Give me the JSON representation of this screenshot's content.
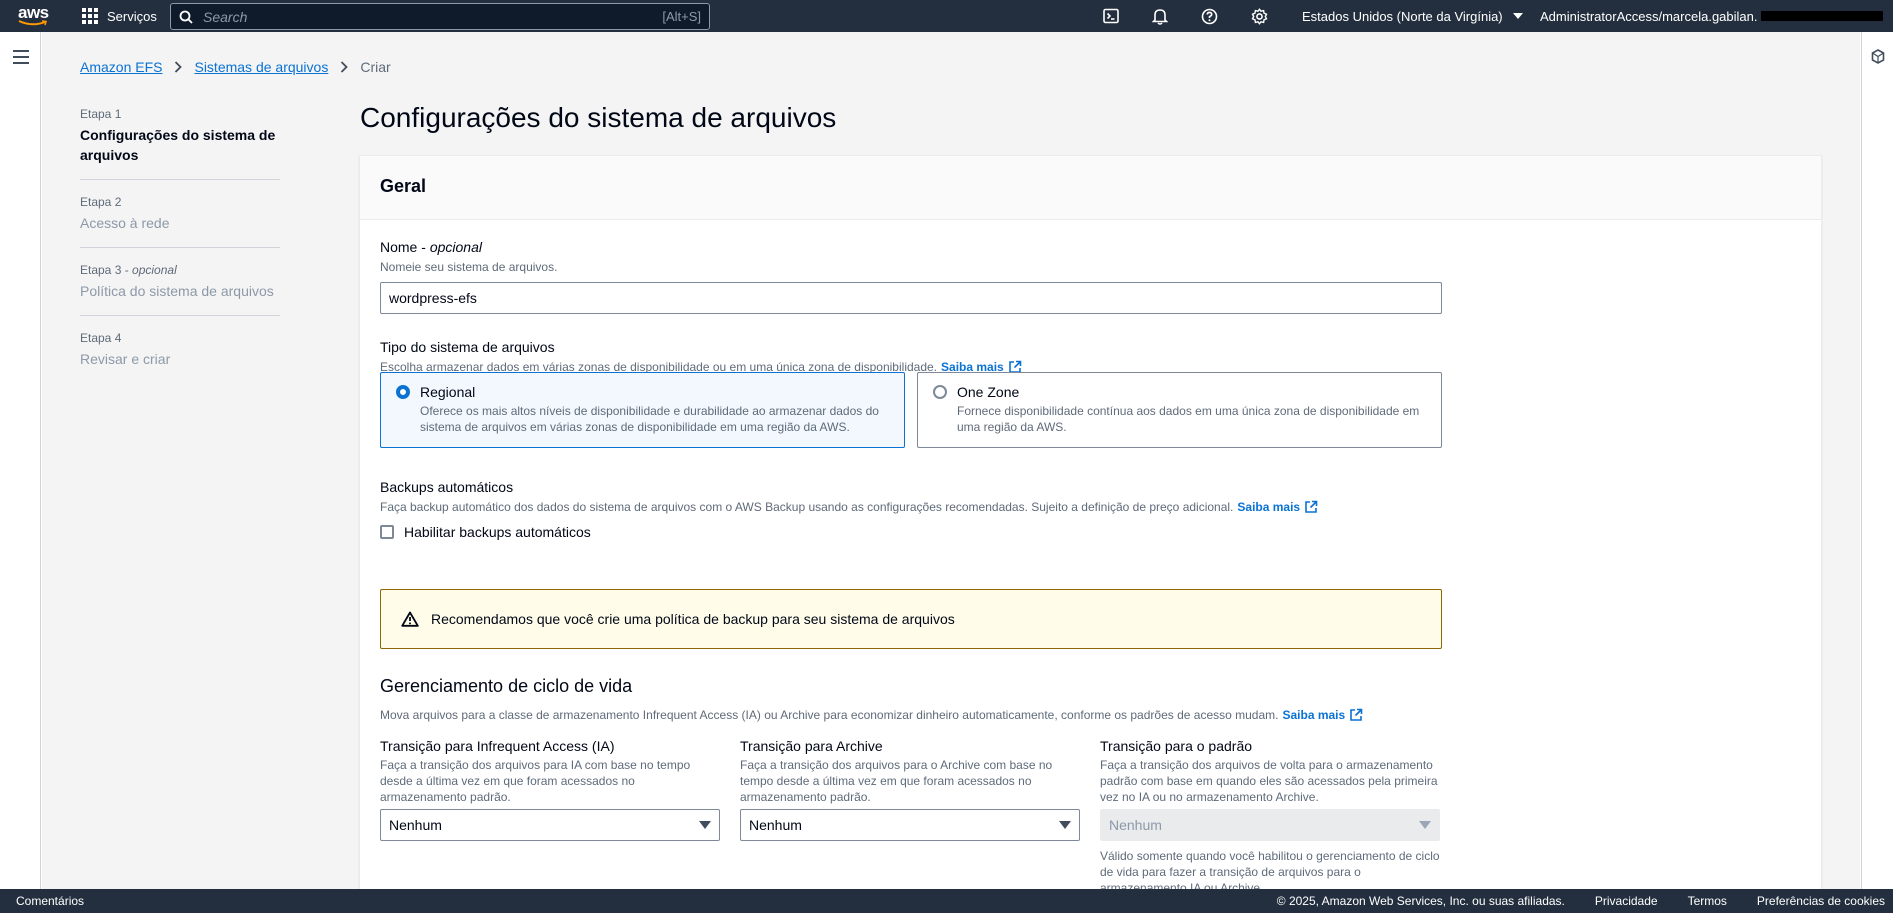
{
  "topnav": {
    "logo_text": "aws",
    "services_label": "Serviços",
    "search_placeholder": "Search",
    "search_shortcut": "[Alt+S]",
    "icons": [
      "cloudshell-icon",
      "bell-icon",
      "help-icon",
      "gear-icon"
    ],
    "region_label": "Estados Unidos (Norte da Virgínia)",
    "account_label": "AdministratorAccess/marcela.gabilan."
  },
  "breadcrumb": {
    "items": [
      "Amazon EFS",
      "Sistemas de arquivos"
    ],
    "current": "Criar"
  },
  "steps": [
    {
      "number": "Etapa 1",
      "optional": "",
      "title": "Configurações do sistema de arquivos",
      "active": true
    },
    {
      "number": "Etapa 2",
      "optional": "",
      "title": "Acesso à rede",
      "active": false
    },
    {
      "number": "Etapa 3",
      "optional": "opcional",
      "title": "Política do sistema de arquivos",
      "active": false
    },
    {
      "number": "Etapa 4",
      "optional": "",
      "title": "Revisar e criar",
      "active": false
    }
  ],
  "page_title": "Configurações do sistema de arquivos",
  "general": {
    "header": "Geral",
    "name_label": "Nome",
    "name_optional": "opcional",
    "name_desc": "Nomeie seu sistema de arquivos.",
    "name_value": "wordpress-efs",
    "type_label": "Tipo do sistema de arquivos",
    "type_desc": "Escolha armazenar dados em várias zonas de disponibilidade ou em uma única zona de disponibilidade.",
    "learn_more": "Saiba mais",
    "tiles": [
      {
        "title": "Regional",
        "desc": "Oferece os mais altos níveis de disponibilidade e durabilidade ao armazenar dados do sistema de arquivos em várias zonas de disponibilidade em uma região da AWS.",
        "selected": true
      },
      {
        "title": "One Zone",
        "desc": "Fornece disponibilidade contínua aos dados em uma única zona de disponibilidade em uma região da AWS.",
        "selected": false
      }
    ],
    "backup_label": "Backups automáticos",
    "backup_desc": "Faça backup automático dos dados do sistema de arquivos com o AWS Backup usando as configurações recomendadas. Sujeito a definição de preço adicional.",
    "backup_checkbox_label": "Habilitar backups automáticos",
    "backup_checked": false,
    "alert_text": "Recomendamos que você crie uma política de backup para seu sistema de arquivos",
    "lifecycle_title": "Gerenciamento de ciclo de vida",
    "lifecycle_desc": "Mova arquivos para a classe de armazenamento Infrequent Access (IA) ou Archive para economizar dinheiro automaticamente, conforme os padrões de acesso mudam.",
    "transitions": [
      {
        "label": "Transição para Infrequent Access (IA)",
        "desc": "Faça a transição dos arquivos para IA com base no tempo desde a última vez em que foram acessados no armazenamento padrão.",
        "value": "Nenhum",
        "disabled": false
      },
      {
        "label": "Transição para Archive",
        "desc": "Faça a transição dos arquivos para o Archive com base no tempo desde a última vez em que foram acessados no armazenamento padrão.",
        "value": "Nenhum",
        "disabled": false
      },
      {
        "label": "Transição para o padrão",
        "desc": "Faça a transição dos arquivos de volta para o armazenamento padrão com base em quando eles são acessados pela primeira vez no IA ou no armazenamento Archive.",
        "value": "Nenhum",
        "disabled": true
      }
    ],
    "transition_note": "Válido somente quando você habilitou o gerenciamento de ciclo de vida para fazer a transição de arquivos para o armazenamento IA ou Archive."
  },
  "footer": {
    "comments": "Comentários",
    "copyright": "© 2025, Amazon Web Services, Inc. ou suas afiliadas.",
    "privacy": "Privacidade",
    "terms": "Termos",
    "cookies": "Preferências de cookies"
  },
  "colors": {
    "nav_bg": "#232f3e",
    "link": "#0972d3",
    "alert_bg": "#fffce9",
    "alert_border": "#8d6605"
  }
}
